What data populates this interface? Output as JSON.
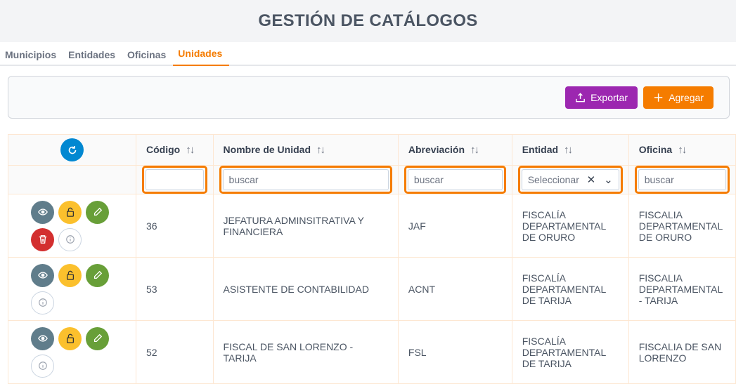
{
  "header": {
    "title": "GESTIÓN DE CATÁLOGOS"
  },
  "tabs": [
    {
      "label": "Municipios",
      "active": false
    },
    {
      "label": "Entidades",
      "active": false
    },
    {
      "label": "Oficinas",
      "active": false
    },
    {
      "label": "Unidades",
      "active": true
    }
  ],
  "toolbar": {
    "export_label": "Exportar",
    "add_label": "Agregar"
  },
  "colors": {
    "accent": "#f57c00",
    "export": "#9c27b0",
    "refresh": "#0288d1",
    "view": "#607d8b",
    "lock": "#fbc02d",
    "edit": "#689f38",
    "delete": "#d32f2f"
  },
  "table": {
    "columns": [
      "Código",
      "Nombre de Unidad",
      "Abreviación",
      "Entidad",
      "Oficina"
    ],
    "filters": {
      "codigo": "",
      "nombre_placeholder": "buscar",
      "abreviacion_placeholder": "buscar",
      "entidad_placeholder": "Seleccionar",
      "oficina_placeholder": "buscar"
    },
    "rows": [
      {
        "codigo": "36",
        "nombre": "JEFATURA ADMINSITRATIVA Y FINANCIERA",
        "abreviacion": "JAF",
        "entidad": "FISCALÍA DEPARTAMENTAL DE ORURO",
        "oficina": "FISCALIA DEPARTAMENTAL DE ORURO"
      },
      {
        "codigo": "53",
        "nombre": "ASISTENTE DE CONTABILIDAD",
        "abreviacion": "ACNT",
        "entidad": "FISCALÍA DEPARTAMENTAL DE TARIJA",
        "oficina": "FISCALIA DEPARTAMENTAL - TARIJA"
      },
      {
        "codigo": "52",
        "nombre": "FISCAL DE SAN LORENZO - TARIJA",
        "abreviacion": "FSL",
        "entidad": "FISCALÍA DEPARTAMENTAL DE TARIJA",
        "oficina": "FISCALIA DE SAN LORENZO"
      }
    ]
  }
}
